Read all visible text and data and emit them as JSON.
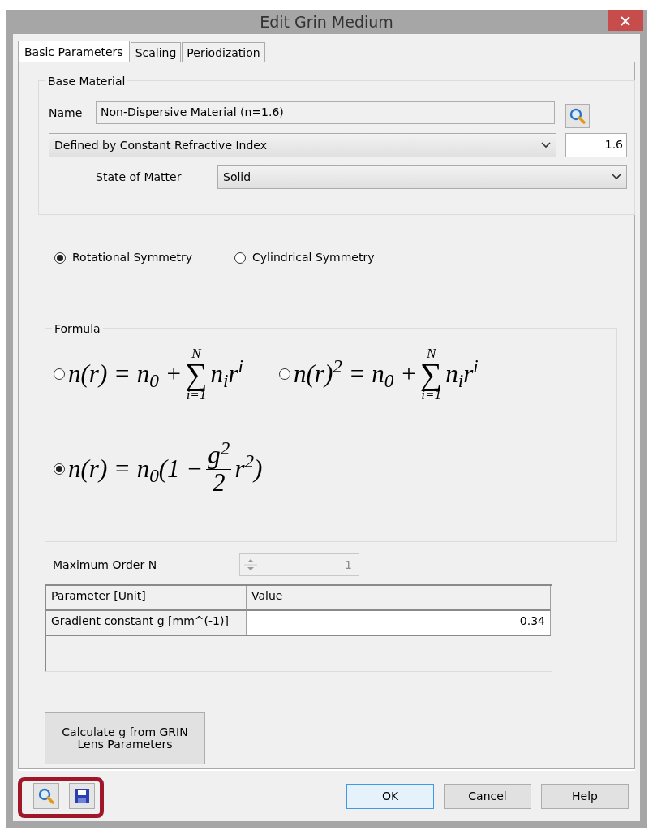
{
  "window": {
    "title": "Edit Grin Medium"
  },
  "tabs": [
    {
      "label": "Basic Parameters",
      "selected": true
    },
    {
      "label": "Scaling",
      "selected": false
    },
    {
      "label": "Periodization",
      "selected": false
    }
  ],
  "base_material": {
    "legend": "Base Material",
    "name_label": "Name",
    "name_value": "Non-Dispersive Material (n=1.6)",
    "definition": "Defined by Constant Refractive Index",
    "index_value": "1.6",
    "state_label": "State of Matter",
    "state_value": "Solid"
  },
  "symmetry": [
    {
      "label": "Rotational Symmetry",
      "selected": true
    },
    {
      "label": "Cylindrical Symmetry",
      "selected": false
    }
  ],
  "formula": {
    "legend": "Formula",
    "options": [
      {
        "selected": false,
        "parts": [
          {
            "kind": "text",
            "text": "n(r) = n$_{0}$ +"
          },
          {
            "kind": "sum",
            "symbol": "∑",
            "upper": "N",
            "lower": "i=1"
          },
          {
            "kind": "text",
            "text": "n$_{i}$r$^{i}$"
          }
        ]
      },
      {
        "selected": false,
        "parts": [
          {
            "kind": "text",
            "text": "n(r)$^{2}$ = n$_{0}$ +"
          },
          {
            "kind": "sum",
            "symbol": "∑",
            "upper": "N",
            "lower": "i=1"
          },
          {
            "kind": "text",
            "text": "n$_{i}$r$^{i}$"
          }
        ]
      },
      {
        "selected": true,
        "parts": [
          {
            "kind": "text",
            "text": "n(r) = n$_{0}$(1 −"
          },
          {
            "kind": "frac",
            "num": "g$^{2}$",
            "den": "2"
          },
          {
            "kind": "text",
            "text": "r$^{2}$)"
          }
        ]
      }
    ]
  },
  "max_order": {
    "label": "Maximum Order N",
    "value": "1",
    "disabled": true
  },
  "table": {
    "columns": [
      "Parameter [Unit]",
      "Value"
    ],
    "rows": [
      [
        "Gradient constant g [mm^(-1)]",
        "0.34"
      ]
    ]
  },
  "calc_button": "Calculate g from GRIN Lens Parameters",
  "footer_buttons": [
    {
      "label": "OK",
      "default": true
    },
    {
      "label": "Cancel",
      "default": false
    },
    {
      "label": "Help",
      "default": false
    }
  ]
}
